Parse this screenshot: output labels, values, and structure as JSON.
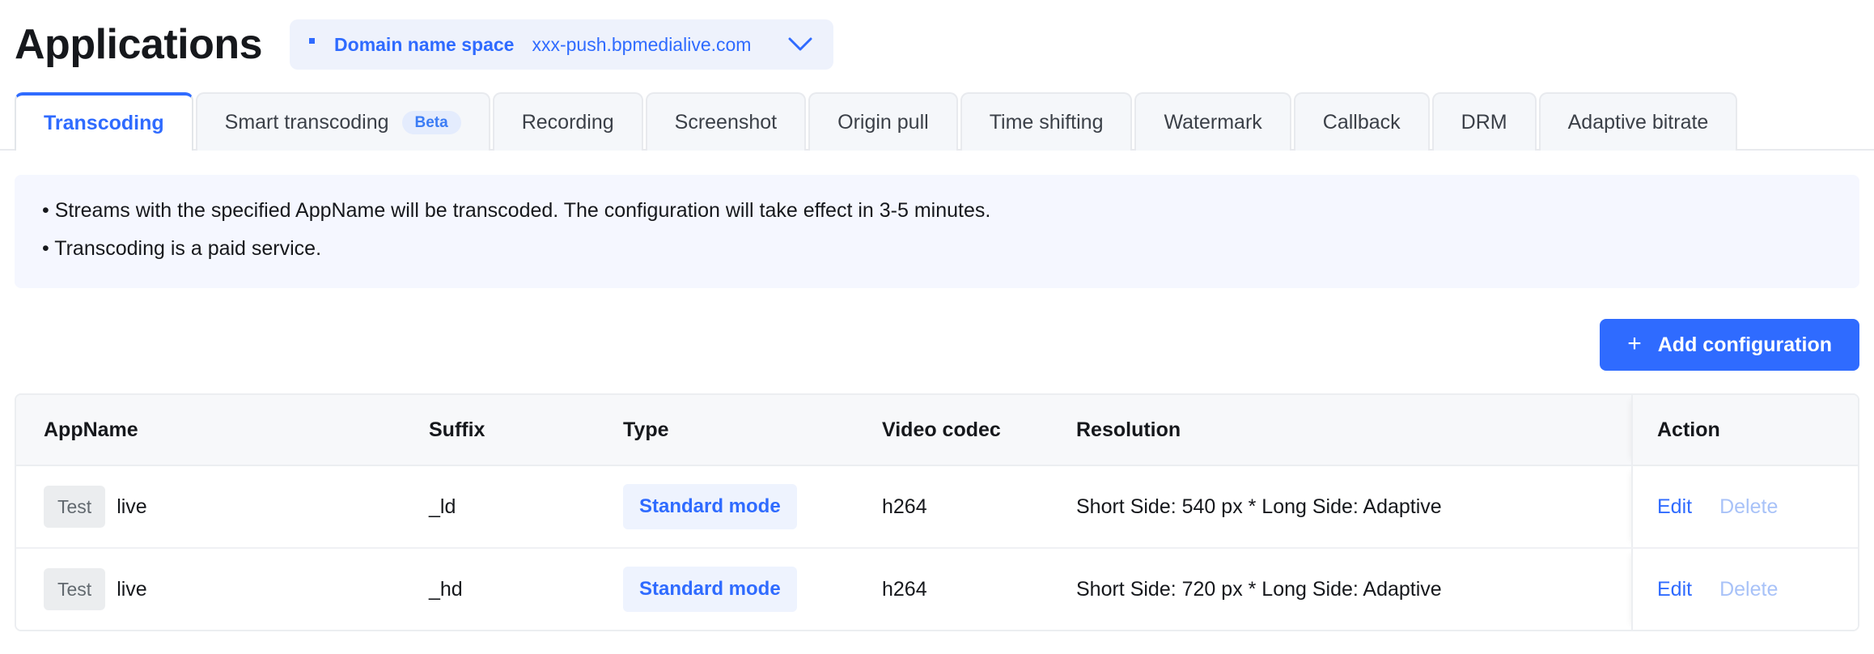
{
  "header": {
    "title": "Applications",
    "domain_selector": {
      "dot_icon": "square-dot-icon",
      "label": "Domain name space",
      "value": "xxx-push.bpmedialive.com",
      "chevron_icon": "chevron-down-icon",
      "accent_color": "#2f6bff",
      "background_color": "#eef2fc"
    }
  },
  "tabs": {
    "active_index": 0,
    "items": [
      {
        "label": "Transcoding",
        "badge": null
      },
      {
        "label": "Smart transcoding",
        "badge": "Beta"
      },
      {
        "label": "Recording",
        "badge": null
      },
      {
        "label": "Screenshot",
        "badge": null
      },
      {
        "label": "Origin pull",
        "badge": null
      },
      {
        "label": "Time shifting",
        "badge": null
      },
      {
        "label": "Watermark",
        "badge": null
      },
      {
        "label": "Callback",
        "badge": null
      },
      {
        "label": "DRM",
        "badge": null
      },
      {
        "label": "Adaptive bitrate",
        "badge": null
      }
    ]
  },
  "notice": {
    "background_color": "#f5f7ff",
    "lines": [
      "• Streams with the specified AppName will be transcoded. The configuration will take effect in 3-5 minutes.",
      "• Transcoding is a paid service."
    ]
  },
  "toolbar": {
    "add_button": {
      "plus_icon": "plus-icon",
      "label": "Add configuration",
      "background_color": "#2f6bff",
      "text_color": "#ffffff"
    }
  },
  "table": {
    "columns": [
      "AppName",
      "Suffix",
      "Type",
      "Video codec",
      "Resolution",
      "Action"
    ],
    "rows": [
      {
        "appname_badge": "Test",
        "appname": "live",
        "suffix": "_ld",
        "type": "Standard mode",
        "video_codec": "h264",
        "resolution": "Short Side: 540 px * Long Side: Adaptive",
        "actions": {
          "edit": "Edit",
          "delete": "Delete"
        }
      },
      {
        "appname_badge": "Test",
        "appname": "live",
        "suffix": "_hd",
        "type": "Standard mode",
        "video_codec": "h264",
        "resolution": "Short Side: 720 px * Long Side: Adaptive",
        "actions": {
          "edit": "Edit",
          "delete": "Delete"
        }
      }
    ]
  }
}
